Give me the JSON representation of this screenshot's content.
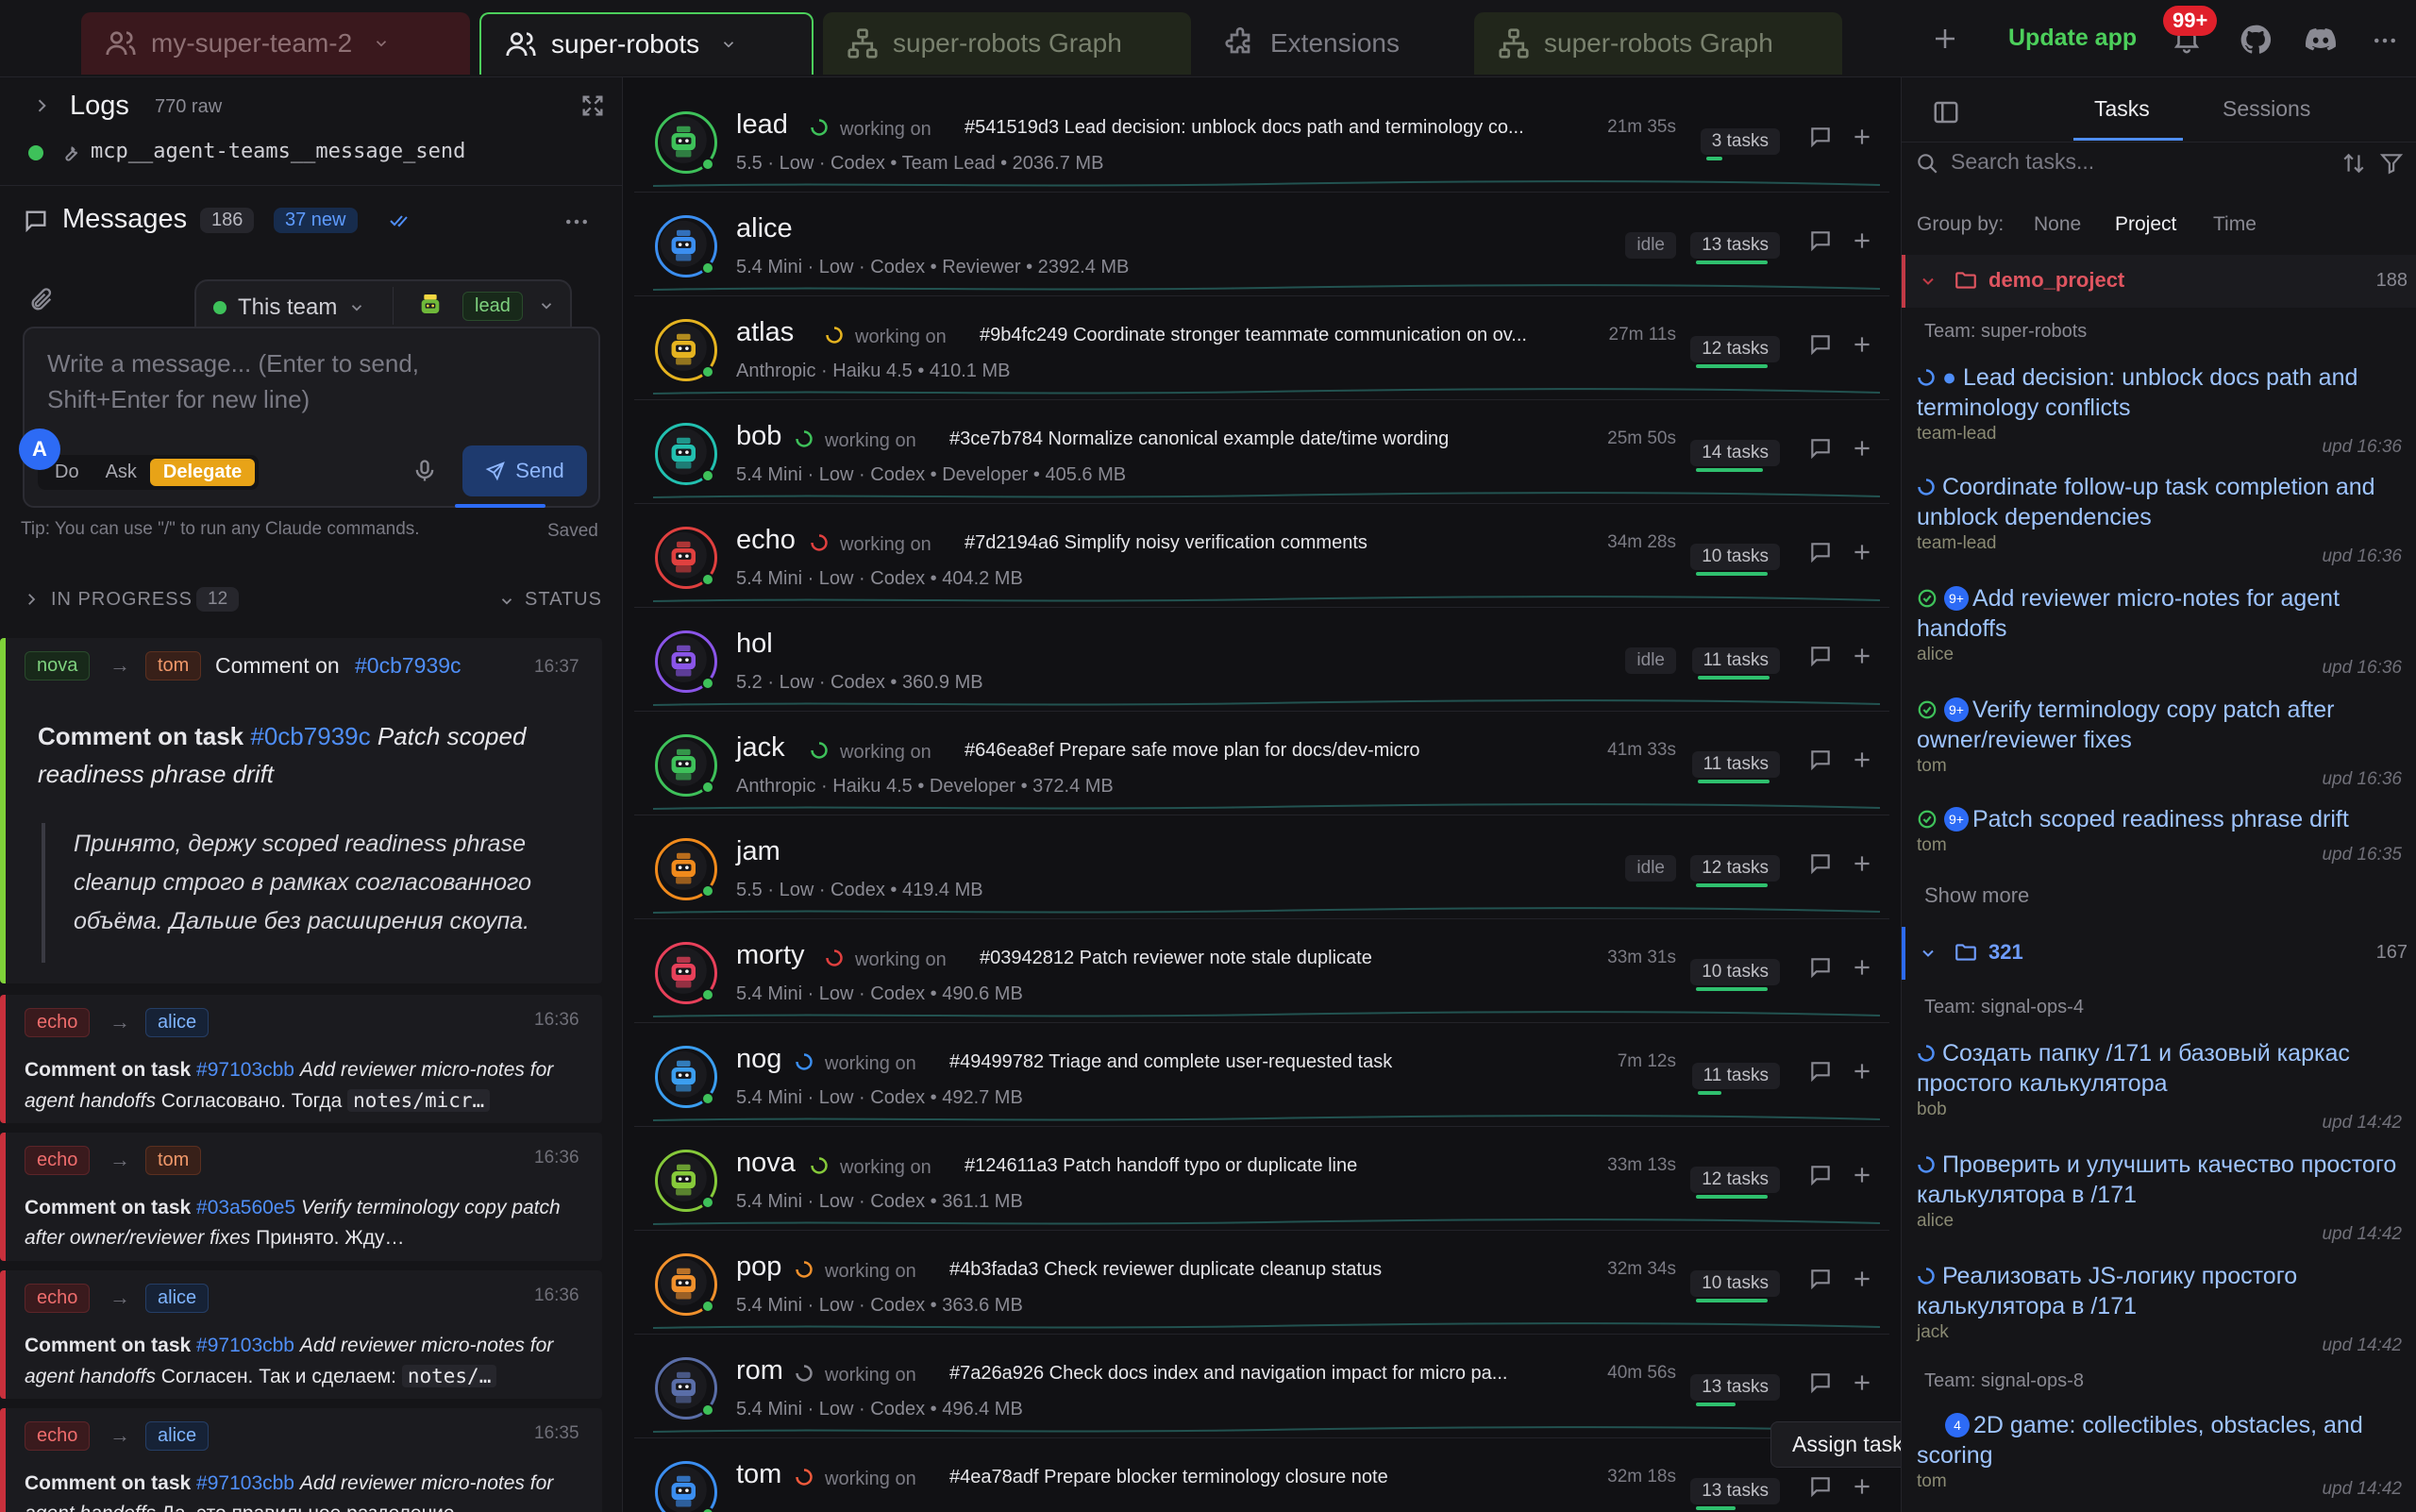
{
  "tabs": [
    {
      "label": "my-super-team-2",
      "icon": "users-icon"
    },
    {
      "label": "super-robots",
      "icon": "users-icon"
    },
    {
      "label": "super-robots Graph",
      "icon": "graph-icon"
    },
    {
      "label": "Extensions",
      "icon": "puzzle-icon"
    },
    {
      "label": "super-robots Graph",
      "icon": "graph-icon"
    }
  ],
  "topbar": {
    "update_label": "Update app",
    "notif_count": "99+"
  },
  "logs": {
    "title": "Logs",
    "count": "770 raw",
    "last_event": "mcp__agent-teams__message_send"
  },
  "messages": {
    "title": "Messages",
    "count": "186",
    "new_count": "37 new"
  },
  "composer": {
    "team_select": "This team",
    "agent_select": "lead",
    "placeholder": "Write a message... (Enter to send, Shift+Enter for new line)",
    "avatar_letter": "A",
    "modes": [
      "Do",
      "Ask",
      "Delegate"
    ],
    "active_mode": "Delegate",
    "send_label": "Send",
    "tip": "Tip: You can use \"/\" to run any Claude commands.",
    "saved": "Saved"
  },
  "in_progress": {
    "label": "IN PROGRESS",
    "count": "12",
    "status_label": "STATUS"
  },
  "feed": [
    {
      "from": "nova",
      "to": "tom",
      "head": "Comment on",
      "ref": "#0cb7939c",
      "time": "16:37",
      "body_prefix": "Comment on task",
      "body_ref": "#0cb7939c",
      "body_title": "Patch scoped readiness phrase drift",
      "quote": "Принято, держу scoped readiness phrase cleanup строго в рамках согласованного объёма. Дальше без расширения скоупа."
    },
    {
      "from": "echo",
      "to": "alice",
      "time": "16:36",
      "prefix": "Comment on task",
      "ref": "#97103cbb",
      "title": "Add reviewer micro-notes for agent handoffs",
      "text": "Согласовано. Тогда",
      "code": "notes/micr…"
    },
    {
      "from": "echo",
      "to": "tom",
      "time": "16:36",
      "prefix": "Comment on task",
      "ref": "#03a560e5",
      "title": "Verify terminology copy patch after owner/reviewer fixes",
      "text": "Принято. Жду…",
      "code": ""
    },
    {
      "from": "echo",
      "to": "alice",
      "time": "16:36",
      "prefix": "Comment on task",
      "ref": "#97103cbb",
      "title": "Add reviewer micro-notes for agent handoffs",
      "text": "Согласен. Так и сделаем:",
      "code": "notes/…"
    },
    {
      "from": "echo",
      "to": "alice",
      "time": "16:35",
      "prefix": "Comment on task",
      "ref": "#97103cbb",
      "title": "Add reviewer micro-notes for agent handoffs",
      "text": "Да, это правильное разделение",
      "code": ""
    }
  ],
  "agents": [
    {
      "name": "lead",
      "state": "working on",
      "task": "#541519d3 Lead decision: unblock docs path and terminology co...",
      "meta": "5.5 · Low · Codex  •  Team Lead  •  2036.7 MB",
      "time": "21m 35s",
      "tasks": "3 tasks",
      "color": "#3ec15a",
      "spin": "#3ec15a",
      "bar": 0.2
    },
    {
      "name": "alice",
      "state": "idle",
      "task": "",
      "meta": "5.4 Mini · Low · Codex  •  Reviewer  •  2392.4 MB",
      "time": "",
      "tasks": "13 tasks",
      "color": "#3b8ef0",
      "spin": "",
      "bar": 0.9
    },
    {
      "name": "atlas",
      "state": "working on",
      "task": "#9b4fc249 Coordinate stronger teammate communication on ov...",
      "meta": "Anthropic · Haiku 4.5  •  410.1 MB",
      "time": "27m 11s",
      "tasks": "12 tasks",
      "color": "#e5b320",
      "spin": "#e5b320",
      "bar": 0.9
    },
    {
      "name": "bob",
      "state": "working on",
      "task": "#3ce7b784 Normalize canonical example date/time wording",
      "meta": "5.4 Mini · Low · Codex  •  Developer  •  405.6 MB",
      "time": "25m 50s",
      "tasks": "14 tasks",
      "color": "#22c0b0",
      "spin": "#3ec15a",
      "bar": 0.85
    },
    {
      "name": "echo",
      "state": "working on",
      "task": "#7d2194a6 Simplify noisy verification comments",
      "meta": "5.4 Mini · Low · Codex  •  404.2 MB",
      "time": "34m 28s",
      "tasks": "10 tasks",
      "color": "#e0403f",
      "spin": "#e0403f",
      "bar": 0.9
    },
    {
      "name": "hol",
      "state": "idle",
      "task": "",
      "meta": "5.2 · Low · Codex  •  360.9 MB",
      "time": "",
      "tasks": "11 tasks",
      "color": "#8a55e8",
      "spin": "",
      "bar": 0.9
    },
    {
      "name": "jack",
      "state": "working on",
      "task": "#646ea8ef Prepare safe move plan for docs/dev-micro",
      "meta": "Anthropic · Haiku 4.5  •  Developer  •  372.4 MB",
      "time": "41m 33s",
      "tasks": "11 tasks",
      "color": "#3ec15a",
      "spin": "#3ec15a",
      "bar": 0.9
    },
    {
      "name": "jam",
      "state": "idle",
      "task": "",
      "meta": "5.5 · Low · Codex  •  419.4 MB",
      "time": "",
      "tasks": "12 tasks",
      "color": "#f08a1c",
      "spin": "",
      "bar": 0.9
    },
    {
      "name": "morty",
      "state": "working on",
      "task": "#03942812 Patch reviewer note stale duplicate",
      "meta": "5.4 Mini · Low · Codex  •  490.6 MB",
      "time": "33m 31s",
      "tasks": "10 tasks",
      "color": "#e8405a",
      "spin": "#e0403f",
      "bar": 0.9
    },
    {
      "name": "nog",
      "state": "working on",
      "task": "#49499782 Triage and complete user-requested task",
      "meta": "5.4 Mini · Low · Codex  •  492.7 MB",
      "time": "7m 12s",
      "tasks": "11 tasks",
      "color": "#3b9ef0",
      "spin": "#3b8ef0",
      "bar": 0.3
    },
    {
      "name": "nova",
      "state": "working on",
      "task": "#124611a3 Patch handoff typo or duplicate line",
      "meta": "5.4 Mini · Low · Codex  •  361.1 MB",
      "time": "33m 13s",
      "tasks": "12 tasks",
      "color": "#86c93a",
      "spin": "#86c93a",
      "bar": 0.9
    },
    {
      "name": "pop",
      "state": "working on",
      "task": "#4b3fada3 Check reviewer duplicate cleanup status",
      "meta": "5.4 Mini · Low · Codex  •  363.6 MB",
      "time": "32m 34s",
      "tasks": "10 tasks",
      "color": "#f0902c",
      "spin": "#f0902c",
      "bar": 0.9
    },
    {
      "name": "rom",
      "state": "working on",
      "task": "#7a26a926 Check docs index and navigation impact for micro pa...",
      "meta": "5.4 Mini · Low · Codex  •  496.4 MB",
      "time": "40m 56s",
      "tasks": "13 tasks",
      "color": "#5a6ea8",
      "spin": "#8a8a93",
      "bar": 0.5
    },
    {
      "name": "tom",
      "state": "working on",
      "task": "#4ea78adf Prepare blocker terminology closure note",
      "meta": "",
      "time": "32m 18s",
      "tasks": "13 tasks",
      "color": "#3b8ef0",
      "spin": "#f05a3c",
      "bar": 0.5
    }
  ],
  "tooltip": "Assign task",
  "right": {
    "tabs": [
      "Tasks",
      "Sessions"
    ],
    "search_placeholder": "Search tasks...",
    "group_by_label": "Group by:",
    "group_options": [
      "None",
      "Project",
      "Time"
    ],
    "active_group": "Project",
    "groups": [
      {
        "name": "demo_project",
        "count": "188",
        "team": "Team: super-robots",
        "items": [
          {
            "title": "Lead decision: unblock docs path and terminology conflicts",
            "who": "team-lead",
            "upd": "upd 16:36",
            "status": "progress",
            "dot": true
          },
          {
            "title": "Coordinate follow-up task completion and unblock dependencies",
            "who": "team-lead",
            "upd": "upd 16:36",
            "status": "progress"
          },
          {
            "title": "Add reviewer micro-notes for agent handoffs",
            "who": "alice",
            "upd": "upd 16:36",
            "status": "done",
            "badge": "9+"
          },
          {
            "title": "Verify terminology copy patch after owner/reviewer fixes",
            "who": "tom",
            "upd": "upd 16:36",
            "status": "done",
            "badge": "9+"
          },
          {
            "title": "Patch scoped readiness phrase drift",
            "who": "tom",
            "upd": "upd 16:35",
            "status": "done",
            "badge": "9+"
          }
        ],
        "show_more": "Show more"
      },
      {
        "name": "321",
        "count": "167",
        "team": "Team: signal-ops-4",
        "items": [
          {
            "title": "Создать папку /171 и базовый каркас простого калькулятора",
            "who": "bob",
            "upd": "upd 14:42",
            "status": "progress"
          },
          {
            "title": "Проверить и улучшить качество простого калькулятора в /171",
            "who": "alice",
            "upd": "upd 14:42",
            "status": "progress"
          },
          {
            "title": "Реализовать JS-логику простого калькулятора в /171",
            "who": "jack",
            "upd": "upd 14:42",
            "status": "progress"
          }
        ],
        "team2": "Team: signal-ops-8",
        "item2": {
          "title": "2D game: collectibles, obstacles, and scoring",
          "who": "tom",
          "upd": "upd 14:42",
          "badge": "4"
        }
      }
    ]
  },
  "colors": {
    "accent_green": "#4ccf5b",
    "link_blue": "#4f8ef7",
    "danger_red": "#c8303c",
    "delegate_orange": "#e8a317"
  }
}
